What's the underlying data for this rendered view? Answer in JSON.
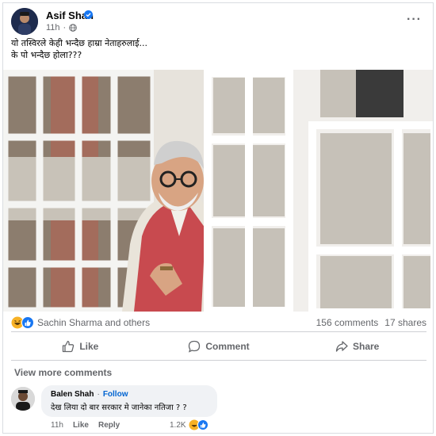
{
  "post": {
    "author": "Asif Shah",
    "time": "11h",
    "caption_line1": "यो तस्विरले केही भन्दैछ हाम्रा नेताहरुलाई...",
    "caption_line2": "के पो भन्दैछ होला???"
  },
  "stats": {
    "reaction_names": "Sachin Sharma and others",
    "comments": "156 comments",
    "shares": "17 shares"
  },
  "actions": {
    "like": "Like",
    "comment": "Comment",
    "share": "Share"
  },
  "view_more": "View more comments",
  "comment": {
    "author": "Balen Shah",
    "separator": "·",
    "follow": "Follow",
    "text": "देख लिया दो बार सरकार मे जानेका नतिजा ? ?",
    "time": "11h",
    "like": "Like",
    "reply": "Reply",
    "reaction_count": "1.2K"
  },
  "colors": {
    "facebook_blue": "#1877f2",
    "secondary_text": "#65676b",
    "link_blue": "#0064d1",
    "bubble_bg": "#f0f2f5",
    "haha_yellow": "#f7b125",
    "vest_red": "#c84a4f"
  },
  "icons": {
    "verified": "verified-badge-icon",
    "more": "more-options-icon",
    "globe": "globe-icon",
    "like": "thumbs-up-icon",
    "comment": "comment-bubble-icon",
    "share": "share-arrow-icon",
    "haha": "haha-reaction-icon",
    "like_reaction": "like-reaction-icon"
  }
}
